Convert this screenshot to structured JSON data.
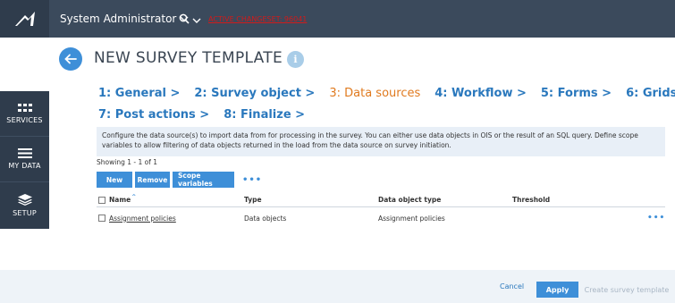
{
  "header": {
    "user_label": "System Administrator",
    "warning_link": "ACTIVE CHANGESET: 96041"
  },
  "sidebar": {
    "items": [
      {
        "label": "SERVICES",
        "icon": "grid-icon"
      },
      {
        "label": "MY DATA",
        "icon": "menu-icon"
      },
      {
        "label": "SETUP",
        "icon": "layers-icon"
      }
    ]
  },
  "page": {
    "title": "NEW SURVEY TEMPLATE",
    "info_icon_glyph": "i"
  },
  "steps": [
    {
      "label": "1: General >",
      "active": false
    },
    {
      "label": "2: Survey object >",
      "active": false
    },
    {
      "label": "3: Data sources",
      "active": true
    },
    {
      "label": "4: Workflow >",
      "active": false
    },
    {
      "label": "5: Forms >",
      "active": false
    },
    {
      "label": "6: Grids >",
      "active": false
    },
    {
      "label": "7: Post actions >",
      "active": false
    },
    {
      "label": "8: Finalize >",
      "active": false
    }
  ],
  "description": "Configure the data source(s) to import data from for processing in the survey. You can either use data objects in OIS or the result of an SQL query. Define scope variables to allow filtering of data objects returned in the load from the data source on survey initiation.",
  "showing": "Showing 1 - 1 of 1",
  "toolbar": {
    "new_label": "New",
    "remove_label": "Remove",
    "scope_label": "Scope variables",
    "more_label": "•••"
  },
  "table": {
    "columns": [
      "Name",
      "Type",
      "Data object type",
      "Threshold"
    ],
    "sort_indicator": "^",
    "rows": [
      {
        "name": "Assignment policies",
        "type": "Data objects",
        "data_object_type": "Assignment policies",
        "threshold": "",
        "more": "•••"
      }
    ]
  },
  "footer": {
    "cancel_label": "Cancel",
    "apply_label": "Apply",
    "create_label": "Create survey template"
  },
  "colors": {
    "topbar": "#3b4a5c",
    "accent": "#3e8fd8",
    "active_step": "#e07a1f",
    "warning": "#d21a1a"
  }
}
